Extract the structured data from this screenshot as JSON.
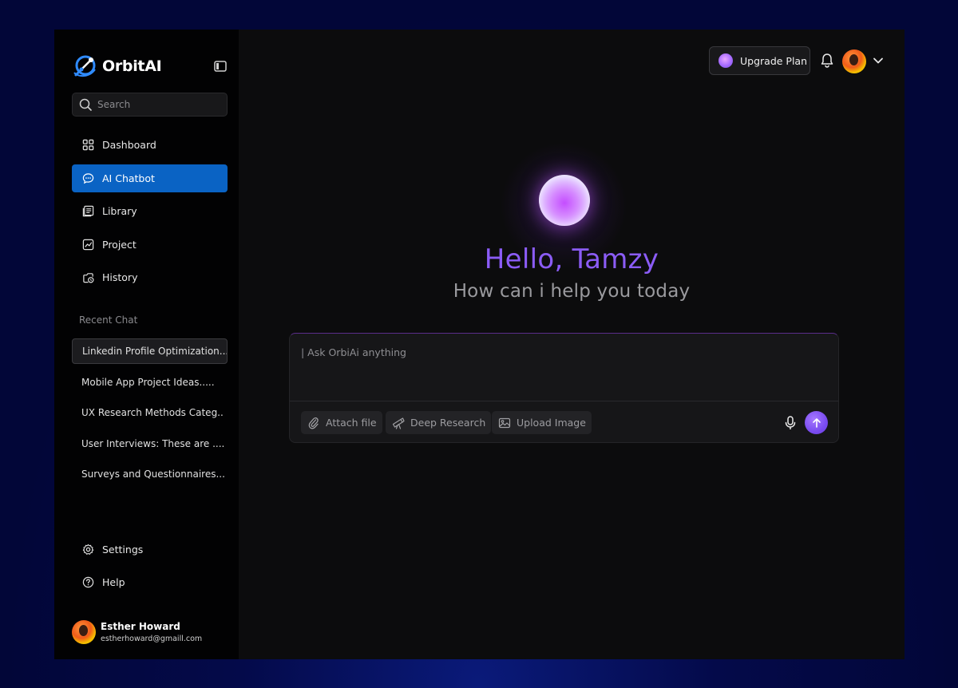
{
  "brand": {
    "name": "OrbitAI"
  },
  "search": {
    "placeholder": "Search"
  },
  "nav": {
    "items": [
      {
        "label": "Dashboard"
      },
      {
        "label": "AI Chatbot"
      },
      {
        "label": "Library"
      },
      {
        "label": "Project"
      },
      {
        "label": "History"
      }
    ],
    "active": "AI Chatbot"
  },
  "recent": {
    "label": "Recent Chat",
    "items": [
      "Linkedin Profile Optimization...",
      "Mobile App Project Ideas.....",
      "UX Research Methods Categ..",
      "User Interviews: These are ....",
      "Surveys and Questionnaires..."
    ]
  },
  "bottom_nav": {
    "settings": "Settings",
    "help": "Help"
  },
  "profile": {
    "name": "Esther Howard",
    "email": "estherhoward@gmaill.com"
  },
  "header": {
    "upgrade_label": "Upgrade Plan"
  },
  "hero": {
    "greeting": "Hello, Tamzy",
    "subtitle": "How can i help you today"
  },
  "composer": {
    "placeholder": "| Ask OrbiAi anything",
    "attach_label": "Attach file",
    "research_label": "Deep Research",
    "upload_label": "Upload Image"
  },
  "colors": {
    "accent": "#0a63c4",
    "greeting": "#8b5cf6",
    "send": "#7a4cf0",
    "background": "#040a4a"
  }
}
